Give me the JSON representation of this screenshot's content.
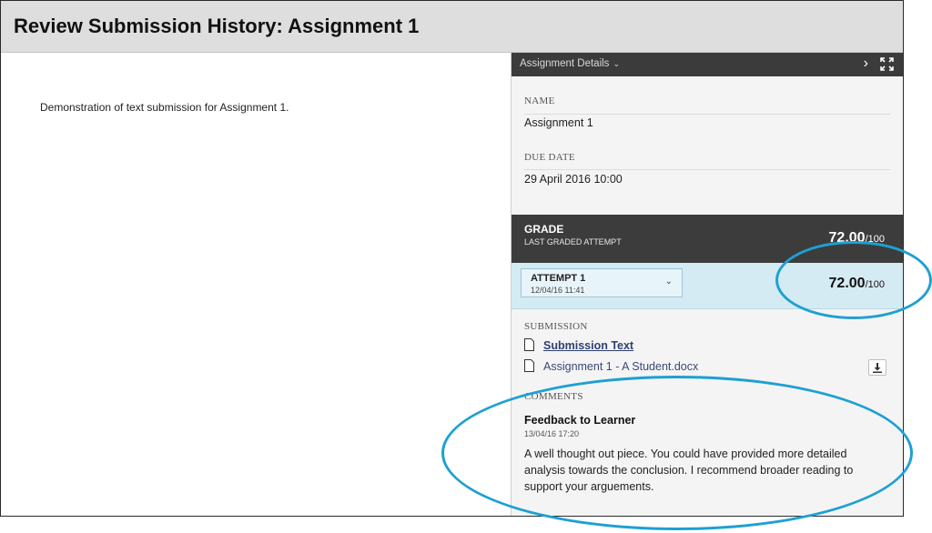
{
  "page": {
    "title": "Review Submission History: Assignment 1"
  },
  "left": {
    "submission_text": "Demonstration of text submission for Assignment 1."
  },
  "panel": {
    "header_label": "Assignment Details",
    "name_label": "NAME",
    "name_value": "Assignment 1",
    "due_label": "DUE DATE",
    "due_value": "29 April 2016 10:00"
  },
  "grade": {
    "title": "GRADE",
    "subtitle": "LAST GRADED ATTEMPT",
    "score": "72.00",
    "out_of": "/100"
  },
  "attempt": {
    "title": "ATTEMPT 1",
    "date": "12/04/16 11:41",
    "score": "72.00",
    "out_of": "/100"
  },
  "submission": {
    "label": "SUBMISSION",
    "files": [
      {
        "name": "Submission Text"
      },
      {
        "name": "Assignment 1 - A Student.docx"
      }
    ]
  },
  "comments": {
    "label": "COMMENTS",
    "title": "Feedback to Learner",
    "date": "13/04/16 17:20",
    "text": "A well thought out piece.  You could have provided more detailed analysis towards the conclusion.  I recommend broader reading to support your arguements."
  },
  "colors": {
    "highlight_ellipse": "#1ea0d2",
    "panel_header": "#3b3b3b",
    "attempt_bg": "#d5ebf3"
  },
  "icons": {
    "collapse": "chevron-right-icon",
    "expand": "expand-icon",
    "file": "document-icon",
    "download": "download-icon"
  }
}
